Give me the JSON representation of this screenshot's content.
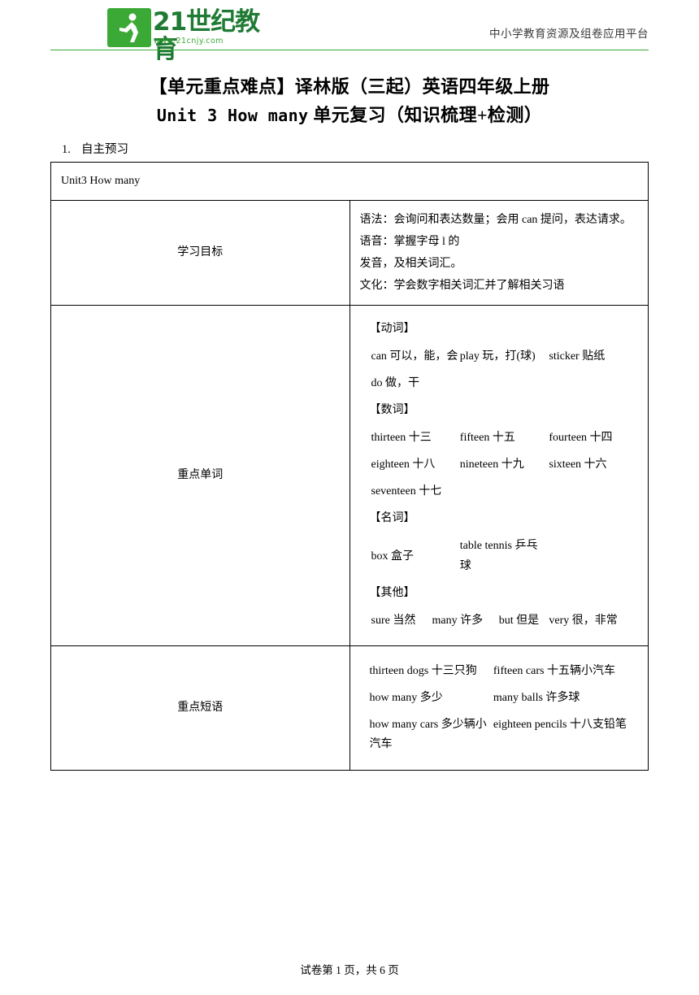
{
  "header": {
    "logo_text": "21世纪教育",
    "logo_sub": "www.21cnjy.com",
    "tagline": "中小学教育资源及组卷应用平台"
  },
  "title": {
    "line1": "【单元重点难点】译林版（三起）英语四年级上册",
    "line2_prefix": "Unit 3 How many",
    "line2_suffix": " 单元复习（知识梳理+检测）"
  },
  "section": {
    "number": "1.",
    "label": "自主预习"
  },
  "table": {
    "unit_head": "Unit3 How many",
    "rows": [
      {
        "label": "学习目标",
        "lines": [
          "语法：会询问和表达数量；会用 can 提问，表达请求。语音：掌握字母 l 的",
          "发音，及相关词汇。",
          "文化：学会数字相关词汇并了解相关习语"
        ]
      },
      {
        "label": "重点单词",
        "groups": [
          {
            "cat": "【动词】",
            "rows": [
              [
                "can  可以，能，会",
                "play   玩，打(球)",
                "sticker  贴纸"
              ],
              [
                "do   做，干",
                "",
                ""
              ]
            ]
          },
          {
            "cat": "【数词】",
            "rows": [
              [
                "thirteen  十三",
                "fifteen   十五",
                "fourteen 十四"
              ],
              [
                "eighteen  十八",
                "nineteen  十九",
                "sixteen 十六"
              ],
              [
                "seventeen  十七",
                "",
                ""
              ]
            ]
          },
          {
            "cat": "【名词】",
            "rows": [
              [
                "box   盒子",
                "table tennis  乒乓球",
                ""
              ]
            ]
          },
          {
            "cat": "【其他】",
            "rows": [
              [
                "sure   当然",
                "many  许多",
                "but 但是",
                "very 很，非常"
              ]
            ]
          }
        ]
      },
      {
        "label": "重点短语",
        "phrases": [
          [
            "thirteen dogs  十三只狗",
            "fifteen cars  十五辆小汽车"
          ],
          [
            "how many   多少",
            "many balls  许多球"
          ],
          [
            "how many cars 多少辆小汽车",
            "eighteen pencils 十八支铅笔"
          ]
        ]
      }
    ]
  },
  "footer": {
    "text": "试卷第 1 页，共 6 页"
  }
}
